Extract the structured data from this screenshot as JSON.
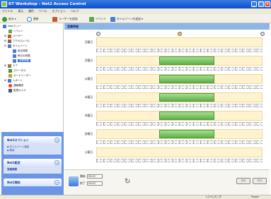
{
  "window": {
    "title": "KT Workshop - Net2 Access Control"
  },
  "menu": [
    "ファイル",
    "表示",
    "操作",
    "ツール",
    "オプション",
    "ヘルプ"
  ],
  "toolbar": {
    "back": "戻る",
    "refresh": "更新",
    "add_user": "ユーザーを追加",
    "events": "イベント",
    "add_timezone": "タイムゾーンを追加"
  },
  "tree": [
    "Net2ビュー",
    "イベント",
    "ユーザー",
    "アクセスレベル",
    "タイムゾーン",
    "設定時間",
    "毎日の時間",
    "営業時間",
    "ドア",
    "ステータス",
    "カードリーダー",
    "レポート",
    "通報確認",
    "監視カメラ"
  ],
  "left_panels": {
    "options": {
      "title": "Net2オプション",
      "items": [
        "タイムゾーン追加",
        "削除"
      ]
    },
    "settings": {
      "title": "Net2設定",
      "items": [
        "営業時間"
      ]
    },
    "resources": {
      "title": "Net2資料"
    }
  },
  "right": {
    "title": "営業時間",
    "days": [
      "日曜日",
      "月曜日",
      "火曜日",
      "水曜日",
      "木曜日",
      "金曜日",
      "土曜日"
    ],
    "holiday": "休日",
    "hours": [
      "0:00",
      "2:00",
      "4:00",
      "6:00",
      "8:00",
      "10:00",
      "12:00",
      "14:00",
      "16:00",
      "18:00",
      "20:00",
      "22:00",
      "24:00"
    ],
    "schedule_start_fraction": 0.375,
    "schedule_end_fraction": 0.708
  },
  "bottom": {
    "start_label": "開始",
    "start_value": "00:00",
    "end_label": "終了",
    "end_value": "00:00",
    "apply": "適用",
    "delete": "削除"
  },
  "status": {
    "left": "",
    "mode": "システムモニタ",
    "right": "Paxton"
  },
  "colors": {
    "title": "#0a4fd1",
    "selection": "#316ac5",
    "bar": "#6ebc56"
  }
}
